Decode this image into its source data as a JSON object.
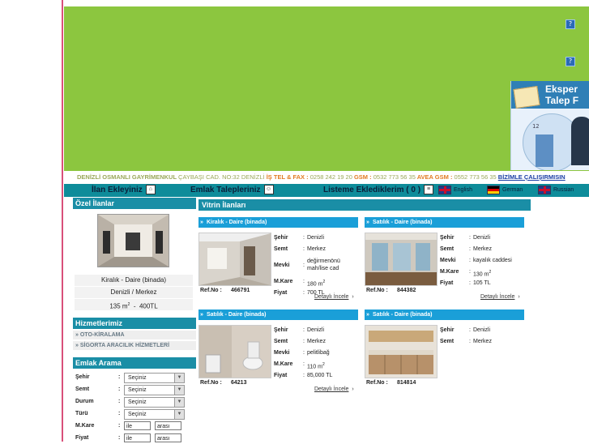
{
  "help_icon_label": "?",
  "promo": {
    "line1": "Eksper",
    "line2": "Talep F",
    "clock": "12"
  },
  "ticker": {
    "company": "DENİZLİ OSMANLI GAYRİMENKUL",
    "address": "ÇAYBAŞI CAD. NO:32 DENİZLİ",
    "tel_label": "İŞ TEL & FAX :",
    "tel": "0258 242 19 20",
    "gsm_label": "GSM :",
    "gsm": "0532 773 56 35",
    "avea_label": "AVEA GSM :",
    "avea": "0552 773 56 35",
    "link": "BİZİMLE ÇALIŞIRMISIN"
  },
  "nav": {
    "add_listing": "İlan Ekleyiniz",
    "requests": "Emlak Talepleriniz",
    "saved": "Listeme Eklediklerim ( 0 )",
    "english": "English",
    "german": "German",
    "russian": "Russian"
  },
  "sidebar": {
    "ozel_title": "Özel İlanlar",
    "ozel_type": "Kiralık - Daire (binada)",
    "ozel_location": "Denizli / Merkez",
    "ozel_area": "135 m",
    "ozel_area_sup": "2",
    "ozel_price_sep": "-",
    "ozel_price": "400TL",
    "services_title": "Hizmetlerimiz",
    "services": [
      "OTO-KİRALAMA",
      "SİGORTA ARACILIK HİZMETLERİ"
    ],
    "search_title": "Emlak Arama",
    "colon": ":",
    "fields": [
      {
        "label": "Şehir",
        "value": "Seçiniz"
      },
      {
        "label": "Semt",
        "value": "Seçiniz"
      },
      {
        "label": "Durum",
        "value": "Seçiniz"
      },
      {
        "label": "Türü",
        "value": "Seçiniz"
      }
    ],
    "range_fields": [
      {
        "label": "M.Kare",
        "min": "ile",
        "max": "arası"
      },
      {
        "label": "Fiyat",
        "min": "ile",
        "max": "arası"
      }
    ]
  },
  "main": {
    "title": "Vitrin İlanları",
    "ref_label": "Ref.No :",
    "detail_label": "Detaylı İncele",
    "arrow": "›",
    "sep": ":",
    "m2_sup": "2",
    "labels": {
      "city": "Şehir",
      "district": "Semt",
      "location": "Mevki",
      "area": "M.Kare",
      "price": "Fiyat"
    },
    "listings": [
      {
        "title": "Kiralık - Daire (binada)",
        "city": "Denizli",
        "district": "Merkez",
        "location": "değirmenönü mah/lise cad",
        "area": "180 m",
        "price": "700 TL",
        "ref": "466791"
      },
      {
        "title": "Satılık - Daire (binada)",
        "city": "Denizli",
        "district": "Merkez",
        "location": "kayalık caddesi",
        "area": "130 m",
        "price": "105 TL",
        "ref": "844382"
      },
      {
        "title": "Satılık - Daire (binada)",
        "city": "Denizli",
        "district": "Merkez",
        "location": "pelitlibağ",
        "area": "110 m",
        "price": "85,000 TL",
        "ref": "64213"
      },
      {
        "title": "Satılık - Daire (binada)",
        "city": "Denizli",
        "district": "Merkez",
        "ref": "814814"
      }
    ]
  },
  "colors": {
    "banner": "#8cc63f",
    "nav": "#0e8c9a",
    "header": "#1a8ea6",
    "listing_bar": "#1a9fd8",
    "accent_line": "#d9507a"
  }
}
